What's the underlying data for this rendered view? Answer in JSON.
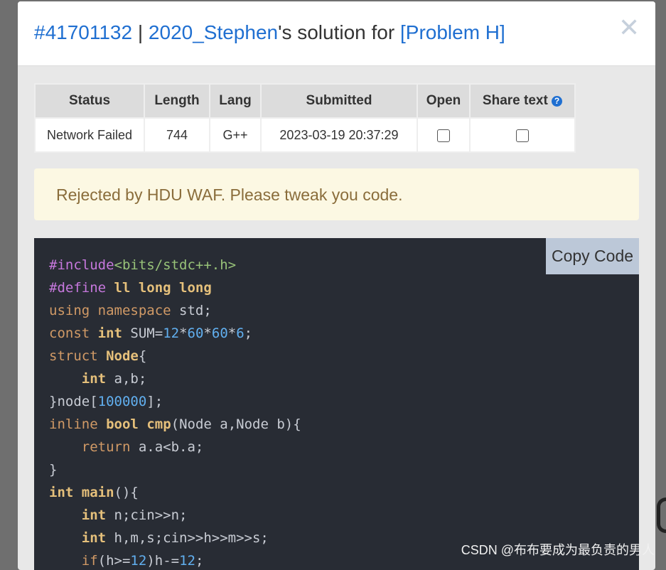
{
  "modal": {
    "title": {
      "id_prefix": "#",
      "submission_id": "41701132",
      "separator": " | ",
      "user": "2020_Stephen",
      "middle": "'s solution for ",
      "problem": "[Problem H]"
    },
    "close_icon": "close-icon"
  },
  "table": {
    "headers": [
      "Status",
      "Length",
      "Lang",
      "Submitted",
      "Open",
      "Share text"
    ],
    "row": {
      "status": "Network Failed",
      "length": "744",
      "lang": "G++",
      "submitted": "2023-03-19 20:37:29"
    }
  },
  "alert": {
    "message": "Rejected by HDU WAF. Please tweak you code."
  },
  "code": {
    "copy_label": "Copy Code",
    "lines": [
      "#include<bits/stdc++.h>",
      "#define ll long long",
      "using namespace std;",
      "const int SUM=12*60*60*6;",
      "struct Node{",
      "    int a,b;",
      "}node[100000];",
      "inline bool cmp(Node a,Node b){",
      "    return a.a<b.a;",
      "}",
      "int main(){",
      "    int n;cin>>n;",
      "    int h,m,s;cin>>h>>m>>s;",
      "    if(h>=12)h-=12;"
    ]
  },
  "watermark": "CSDN @布布要成为最负责的男人",
  "colors": {
    "link": "#1f6fd1",
    "status_failed": "#d9534f",
    "alert_bg": "#fcf8e3",
    "code_bg": "#282c34"
  }
}
